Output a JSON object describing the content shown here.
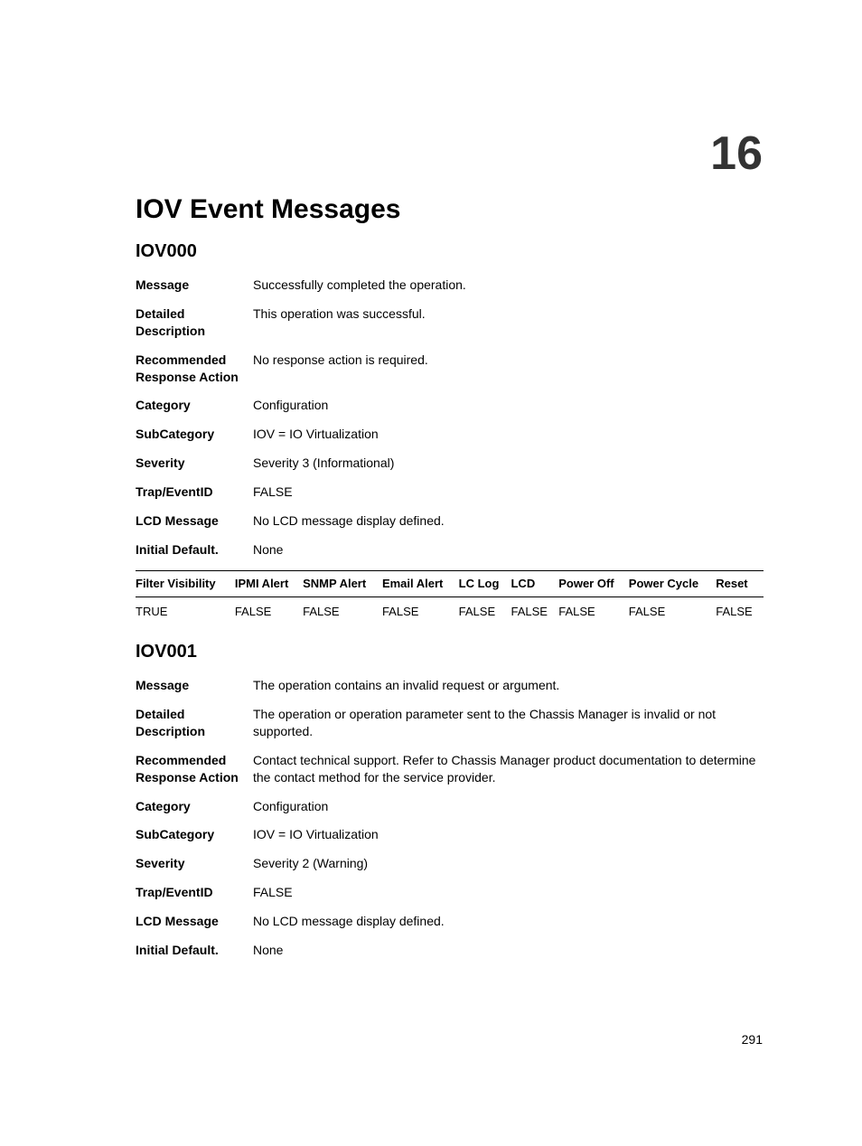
{
  "chapter_number": "16",
  "page_title": "IOV Event Messages",
  "page_number": "291",
  "table_headers": {
    "filter_visibility": "Filter Visibility",
    "ipmi_alert": "IPMI Alert",
    "snmp_alert": "SNMP Alert",
    "email_alert": "Email Alert",
    "lc_log": "LC Log",
    "lcd": "LCD",
    "power_off": "Power Off",
    "power_cycle": "Power Cycle",
    "reset": "Reset"
  },
  "field_labels": {
    "message": "Message",
    "detailed_description": "Detailed Description",
    "recommended_response_action": "Recommended Response Action",
    "category": "Category",
    "subcategory": "SubCategory",
    "severity": "Severity",
    "trap_eventid": "Trap/EventID",
    "lcd_message": "LCD Message",
    "initial_default": "Initial Default."
  },
  "sections": [
    {
      "id": "IOV000",
      "fields": {
        "message": "Successfully completed the operation.",
        "detailed_description": "This operation was successful.",
        "recommended_response_action": "No response action is required.",
        "category": "Configuration",
        "subcategory": "IOV = IO Virtualization",
        "severity": "Severity 3 (Informational)",
        "trap_eventid": "FALSE",
        "lcd_message": "No LCD message display defined.",
        "initial_default": "None"
      },
      "table_row": {
        "filter_visibility": "TRUE",
        "ipmi_alert": "FALSE",
        "snmp_alert": "FALSE",
        "email_alert": "FALSE",
        "lc_log": "FALSE",
        "lcd": "FALSE",
        "power_off": "FALSE",
        "power_cycle": "FALSE",
        "reset": "FALSE"
      }
    },
    {
      "id": "IOV001",
      "fields": {
        "message": "The operation contains an invalid request or argument.",
        "detailed_description": "The operation or operation parameter sent to the Chassis Manager is invalid or not supported.",
        "recommended_response_action": "Contact technical support. Refer to Chassis Manager product documentation to determine the contact method for the service provider.",
        "category": "Configuration",
        "subcategory": "IOV = IO Virtualization",
        "severity": "Severity 2 (Warning)",
        "trap_eventid": "FALSE",
        "lcd_message": "No LCD message display defined.",
        "initial_default": "None"
      }
    }
  ]
}
